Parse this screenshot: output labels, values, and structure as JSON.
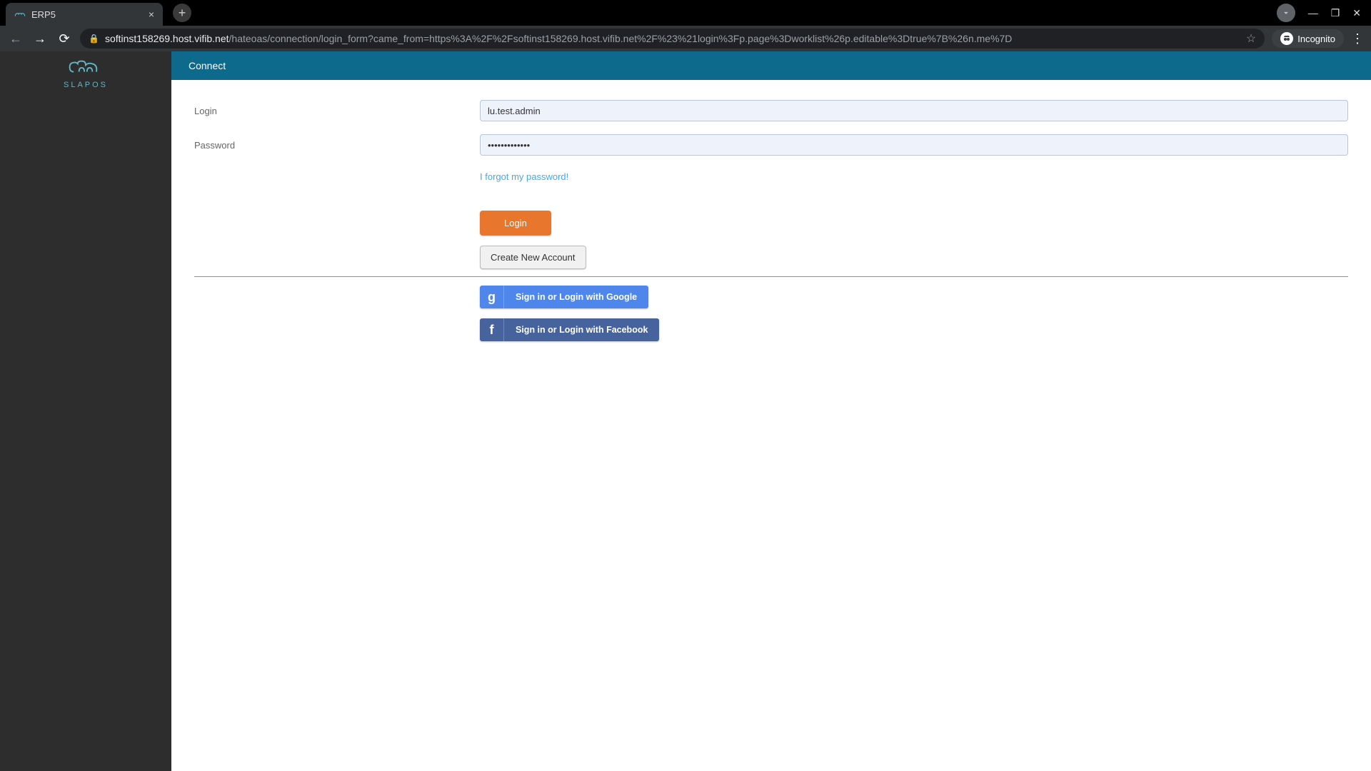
{
  "browser": {
    "tab_title": "ERP5",
    "url_host": "softinst158269.host.vifib.net",
    "url_path": "/hateoas/connection/login_form?came_from=https%3A%2F%2Fsoftinst158269.host.vifib.net%2F%23%21login%3Fp.page%3Dworklist%26p.editable%3Dtrue%7B%26n.me%7D",
    "incognito_label": "Incognito"
  },
  "logo_text": "SLAPOS",
  "header_title": "Connect",
  "form": {
    "login_label": "Login",
    "login_value": "lu.test.admin",
    "password_label": "Password",
    "password_value": "•••••••••••••",
    "forgot_label": "I forgot my password!",
    "login_button": "Login",
    "create_account_button": "Create New Account",
    "google_button": "Sign in or Login with Google",
    "facebook_button": "Sign in or Login with Facebook"
  }
}
